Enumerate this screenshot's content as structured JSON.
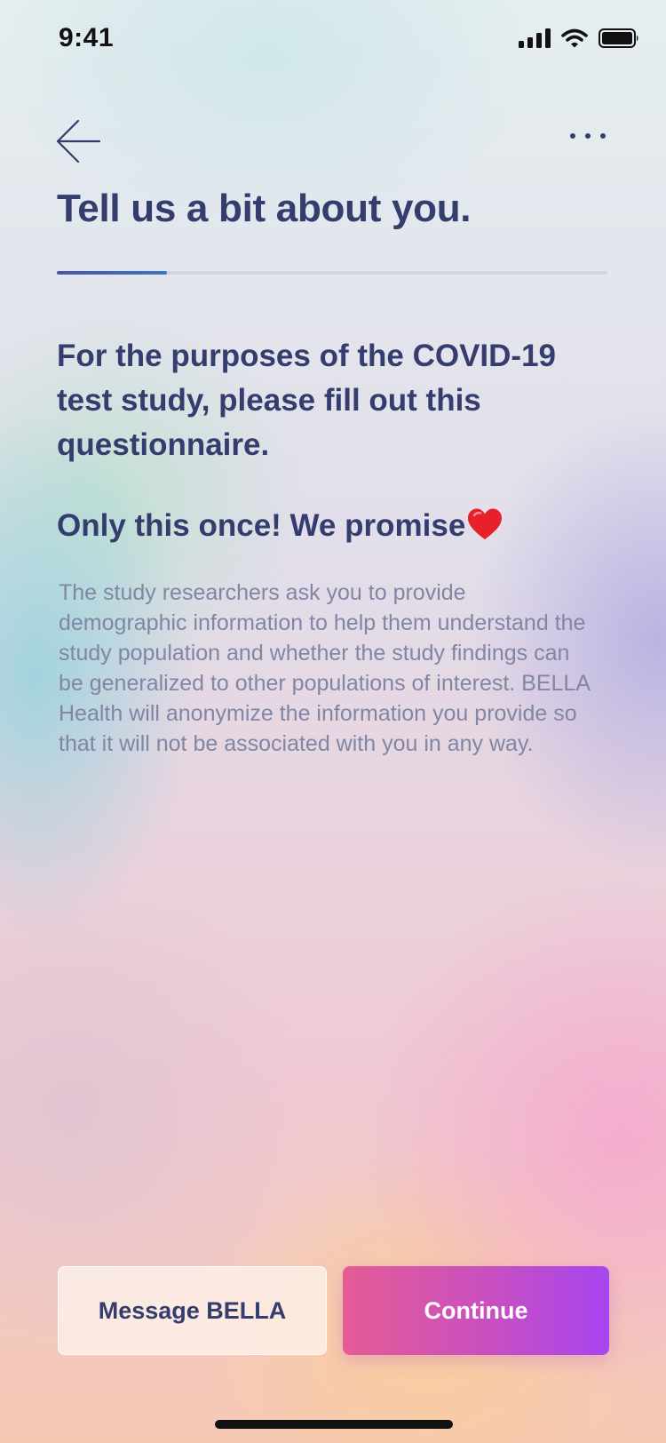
{
  "status_bar": {
    "time": "9:41",
    "icons": [
      "cellular-signal-icon",
      "wifi-icon",
      "battery-icon"
    ]
  },
  "nav": {
    "back_icon": "arrow-left-icon",
    "more_icon": "more-horizontal-icon"
  },
  "header": {
    "title": "Tell us a bit about you."
  },
  "progress": {
    "fraction": 0.2
  },
  "content": {
    "subtitle": "For the purposes of the COVID-19 test study, please fill out this questionnaire.",
    "promise": "Only this once! We promise",
    "promise_emoji": "❤️",
    "body": "The study researchers ask you to provide demographic information to help them understand the study population and whether the study findings can be generalized to other populations of interest. BELLA Health will anonymize the information you provide so that it will not be associated with you in any way."
  },
  "actions": {
    "secondary_label": "Message BELLA",
    "primary_label": "Continue"
  },
  "colors": {
    "heading": "#343d6e",
    "body_text": "#8186a4",
    "progress_fill": "#3d73c4",
    "primary_gradient_start": "#e55c95",
    "primary_gradient_end": "#a745f0",
    "heart": "#e8202a"
  }
}
